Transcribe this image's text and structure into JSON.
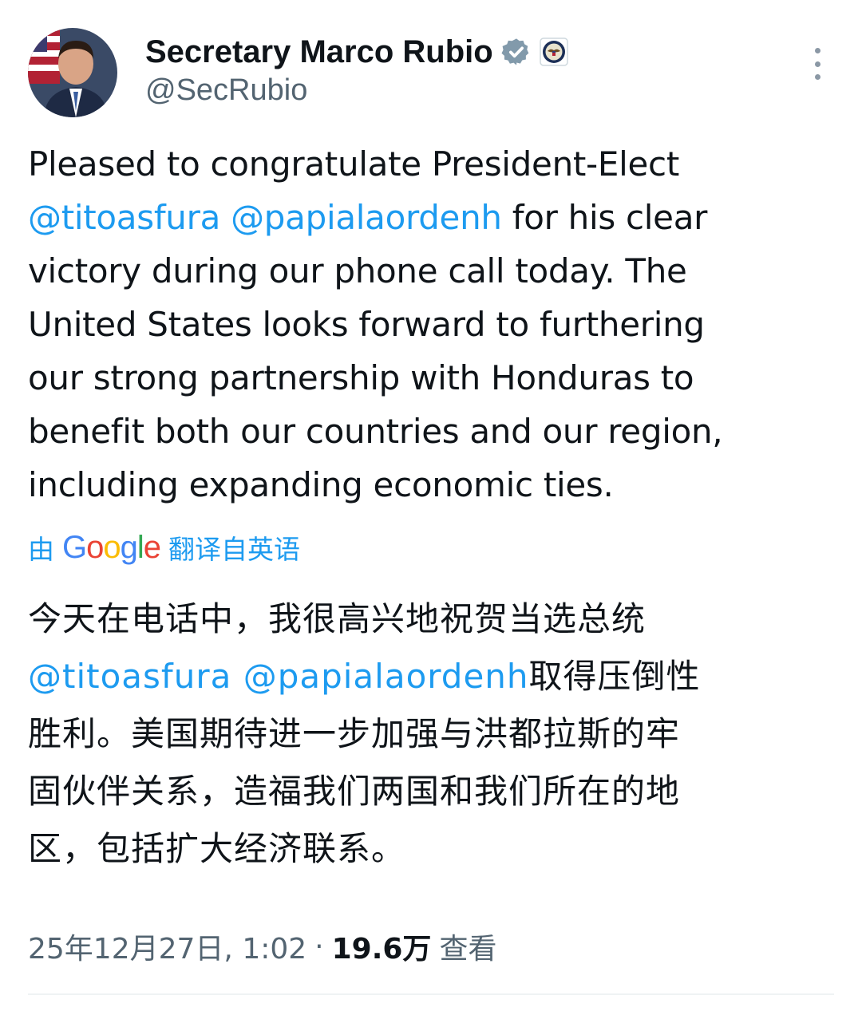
{
  "author": {
    "display_name": "Secretary Marco Rubio",
    "handle": "@SecRubio",
    "verified_icon": "verified-badge-icon",
    "affiliation_icon": "state-department-seal-icon"
  },
  "tweet": {
    "lines": [
      {
        "text": "Pleased to congratulate President-Elect"
      },
      {
        "mention1": "@titoasfura",
        "space": " ",
        "mention2": "@papialaordenh",
        "text": " for his clear"
      },
      {
        "text": "victory during our phone call today. The"
      },
      {
        "text": "United States looks forward to furthering"
      },
      {
        "text": "our strong partnership with Honduras to"
      },
      {
        "text": "benefit both our countries and our region,"
      },
      {
        "text": "including expanding economic ties."
      }
    ]
  },
  "translation": {
    "prefix": "由",
    "google": [
      "G",
      "o",
      "o",
      "g",
      "l",
      "e"
    ],
    "suffix": "翻译自英语"
  },
  "translated": {
    "line1": "今天在电话中，我很高兴地祝贺当选总统",
    "mention1": "@titoasfura",
    "mention2": "@papialaordenh",
    "line2_tail": "取得压倒性",
    "line3": "胜利。美国期待进一步加强与洪都拉斯的牢",
    "line4": "固伙伴关系，造福我们两国和我们所在的地",
    "line5": "区，包括扩大经济联系。"
  },
  "meta": {
    "timestamp": "25年12月27日, 1:02",
    "separator": "·",
    "views": "19.6万",
    "views_label": "查看"
  },
  "colors": {
    "link": "#1d9bf0",
    "text": "#0f1419",
    "muted": "#536471"
  }
}
